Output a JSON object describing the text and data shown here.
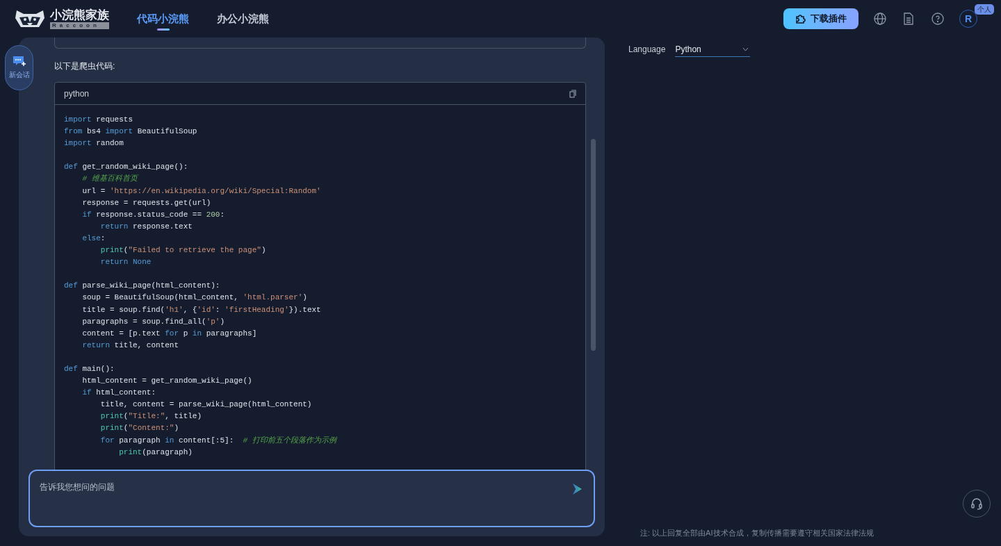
{
  "header": {
    "logo_title": "小浣熊家族",
    "logo_subtitle": "Raccoon",
    "tabs": [
      {
        "label": "代码小浣熊",
        "selected": true
      },
      {
        "label": "办公小浣熊",
        "selected": false
      }
    ],
    "download_button": "下载插件",
    "avatar_initial": "R",
    "avatar_badge": "个人"
  },
  "sidebar": {
    "new_chat": "新会话"
  },
  "chat": {
    "intro": "以下是爬虫代码:",
    "code_block": {
      "language": "python",
      "blocks": [
        [
          [
            {
              "kind": "kw",
              "text": "import"
            },
            {
              "kind": "plain",
              "text": " requests"
            }
          ],
          [
            {
              "kind": "kw",
              "text": "from"
            },
            {
              "kind": "plain",
              "text": " bs4 "
            },
            {
              "kind": "kw",
              "text": "import"
            },
            {
              "kind": "plain",
              "text": " BeautifulSoup"
            }
          ],
          [
            {
              "kind": "kw",
              "text": "import"
            },
            {
              "kind": "plain",
              "text": " random"
            }
          ]
        ],
        [
          [
            {
              "kind": "kw",
              "text": "def"
            },
            {
              "kind": "plain",
              "text": " get_random_wiki_page():"
            }
          ],
          [
            {
              "kind": "comment",
              "text": "    # 维基百科首页"
            }
          ],
          [
            {
              "kind": "plain",
              "text": "    url = "
            },
            {
              "kind": "string",
              "text": "'https://en.wikipedia.org/wiki/Special:Random'"
            }
          ],
          [
            {
              "kind": "plain",
              "text": "    response = requests.get(url)"
            }
          ],
          [
            {
              "kind": "kw",
              "text": "    if"
            },
            {
              "kind": "plain",
              "text": " response.status_code == "
            },
            {
              "kind": "number",
              "text": "200"
            },
            {
              "kind": "plain",
              "text": ":"
            }
          ],
          [
            {
              "kind": "kw",
              "text": "        return"
            },
            {
              "kind": "plain",
              "text": " response.text"
            }
          ],
          [
            {
              "kind": "kw",
              "text": "    else"
            },
            {
              "kind": "plain",
              "text": ":"
            }
          ],
          [
            {
              "kind": "builtin",
              "text": "        print"
            },
            {
              "kind": "plain",
              "text": "("
            },
            {
              "kind": "string",
              "text": "\"Failed to retrieve the page\""
            },
            {
              "kind": "plain",
              "text": ")"
            }
          ],
          [
            {
              "kind": "kw",
              "text": "        return"
            },
            {
              "kind": "kw",
              "text": " None"
            }
          ]
        ],
        [
          [
            {
              "kind": "kw",
              "text": "def"
            },
            {
              "kind": "plain",
              "text": " parse_wiki_page(html_content):"
            }
          ],
          [
            {
              "kind": "plain",
              "text": "    soup = BeautifulSoup(html_content, "
            },
            {
              "kind": "string",
              "text": "'html.parser'"
            },
            {
              "kind": "plain",
              "text": ")"
            }
          ],
          [
            {
              "kind": "plain",
              "text": "    title = soup.find("
            },
            {
              "kind": "string",
              "text": "'h1'"
            },
            {
              "kind": "plain",
              "text": ", {"
            },
            {
              "kind": "string",
              "text": "'id'"
            },
            {
              "kind": "plain",
              "text": ": "
            },
            {
              "kind": "string",
              "text": "'firstHeading'"
            },
            {
              "kind": "plain",
              "text": "}).text"
            }
          ],
          [
            {
              "kind": "plain",
              "text": "    paragraphs = soup.find_all("
            },
            {
              "kind": "string",
              "text": "'p'"
            },
            {
              "kind": "plain",
              "text": ")"
            }
          ],
          [
            {
              "kind": "plain",
              "text": "    content = [p.text "
            },
            {
              "kind": "kw",
              "text": "for"
            },
            {
              "kind": "plain",
              "text": " p "
            },
            {
              "kind": "kw",
              "text": "in"
            },
            {
              "kind": "plain",
              "text": " paragraphs]"
            }
          ],
          [
            {
              "kind": "kw",
              "text": "    return"
            },
            {
              "kind": "plain",
              "text": " title, content"
            }
          ]
        ],
        [
          [
            {
              "kind": "kw",
              "text": "def"
            },
            {
              "kind": "plain",
              "text": " main():"
            }
          ],
          [
            {
              "kind": "plain",
              "text": "    html_content = get_random_wiki_page()"
            }
          ],
          [
            {
              "kind": "kw",
              "text": "    if"
            },
            {
              "kind": "plain",
              "text": " html_content:"
            }
          ],
          [
            {
              "kind": "plain",
              "text": "        title, content = parse_wiki_page(html_content)"
            }
          ],
          [
            {
              "kind": "builtin",
              "text": "        print"
            },
            {
              "kind": "plain",
              "text": "("
            },
            {
              "kind": "string",
              "text": "\"Title:\""
            },
            {
              "kind": "plain",
              "text": ", title)"
            }
          ],
          [
            {
              "kind": "builtin",
              "text": "        print"
            },
            {
              "kind": "plain",
              "text": "("
            },
            {
              "kind": "string",
              "text": "\"Content:\""
            },
            {
              "kind": "plain",
              "text": ")"
            }
          ],
          [
            {
              "kind": "kw",
              "text": "        for"
            },
            {
              "kind": "plain",
              "text": " paragraph "
            },
            {
              "kind": "kw",
              "text": "in"
            },
            {
              "kind": "plain",
              "text": " content[:5]:  "
            },
            {
              "kind": "comment",
              "text": "# 打印前五个段落作为示例"
            }
          ],
          [
            {
              "kind": "builtin",
              "text": "            print"
            },
            {
              "kind": "plain",
              "text": "(paragraph)"
            }
          ]
        ]
      ]
    },
    "input": {
      "placeholder": "告诉我您想问的问题"
    }
  },
  "settings": {
    "language_label": "Language",
    "language_value": "Python"
  },
  "footer_note": "注: 以上回复全部由AI技术合成，复制传播需要遵守相关国家法律法规"
}
